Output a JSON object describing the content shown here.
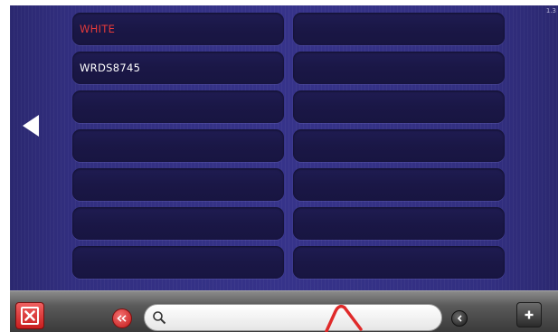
{
  "version_label": "1.3",
  "slots": [
    {
      "label": "WHITE",
      "active": true
    },
    {
      "label": "",
      "active": false
    },
    {
      "label": "WRDS8745",
      "active": false
    },
    {
      "label": "",
      "active": false
    },
    {
      "label": "",
      "active": false
    },
    {
      "label": "",
      "active": false
    },
    {
      "label": "",
      "active": false
    },
    {
      "label": "",
      "active": false
    },
    {
      "label": "",
      "active": false
    },
    {
      "label": "",
      "active": false
    },
    {
      "label": "",
      "active": false
    },
    {
      "label": "",
      "active": false
    },
    {
      "label": "",
      "active": false
    },
    {
      "label": "",
      "active": false
    }
  ],
  "search": {
    "value": "",
    "placeholder": ""
  },
  "icons": {
    "back": "left-arrow-icon",
    "close": "close-icon",
    "rewind": "rewind-icon",
    "search": "magnifier-icon",
    "prev": "chevron-left-icon",
    "add": "plus-icon"
  },
  "colors": {
    "background": "#322f80",
    "slot": "#1c1949",
    "active_text": "#e43a3a",
    "text": "#ffffff",
    "close_button": "#d62828",
    "toolbar": "#4a4a4a"
  }
}
